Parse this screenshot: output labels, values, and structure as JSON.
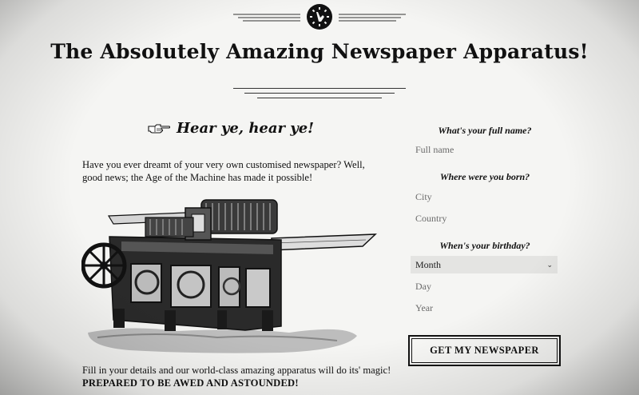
{
  "header": {
    "emblem_icon": "gear-wrench-emblem-icon",
    "title": "The Absolutely Amazing Newspaper Apparatus!"
  },
  "intro": {
    "heading_icon": "pointing-hand-icon",
    "heading": "Hear ye, hear ye!",
    "text": "Have you ever dreamt of your very own customised newspaper? Well, good news; the Age of the Machine has made it possible!",
    "image_icon": "printing-press-illustration"
  },
  "footer_text": {
    "line1": "Fill in your details and our world-class amazing apparatus will do its' magic!",
    "line2": "PREPARED TO BE AWED AND ASTOUNDED!"
  },
  "form": {
    "name_question": "What's your full name?",
    "name_placeholder": "Full name",
    "born_question": "Where were you born?",
    "city_placeholder": "City",
    "country_placeholder": "Country",
    "birthday_question": "When's your birthday?",
    "month_selected": "Month",
    "day_placeholder": "Day",
    "year_placeholder": "Year",
    "submit_label": "GET MY NEWSPAPER"
  },
  "colors": {
    "ink": "#111111",
    "paper": "#f5f5f3",
    "select_bg": "#e4e4e2"
  }
}
